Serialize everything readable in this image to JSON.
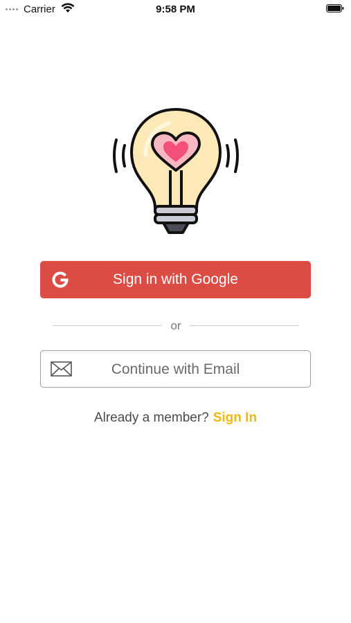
{
  "status_bar": {
    "carrier": "Carrier",
    "time": "9:58 PM"
  },
  "logo": {
    "icon": "lightbulb-heart-icon"
  },
  "auth": {
    "google_button_label": "Sign in with Google",
    "divider_text": "or",
    "email_button_label": "Continue with Email",
    "member_prompt": "Already a member?",
    "signin_link": "Sign In"
  },
  "colors": {
    "google_red": "#db4d44",
    "link_yellow": "#f3b800"
  }
}
